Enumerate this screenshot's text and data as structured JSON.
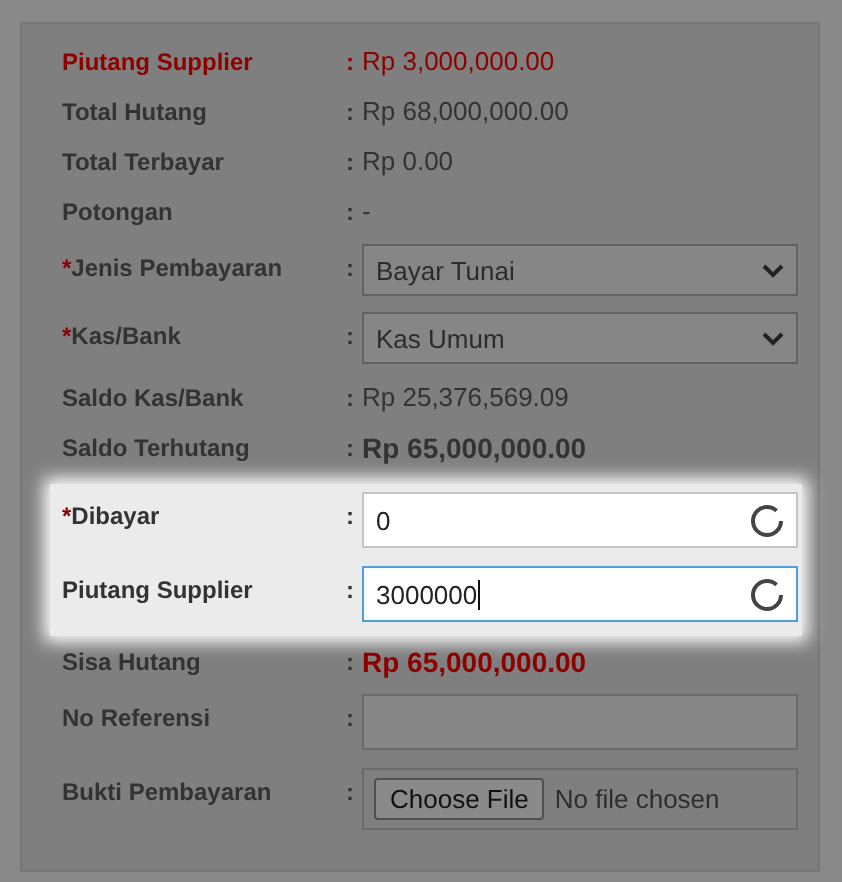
{
  "rows": [
    {
      "kind": "text",
      "label": "Piutang Supplier",
      "colon": ":",
      "value": "Rp 3,000,000.00",
      "alert": true,
      "label_alert": true,
      "bold": false,
      "highlighted": false
    },
    {
      "kind": "text",
      "label": "Total Hutang",
      "colon": ":",
      "value": "Rp 68,000,000.00",
      "alert": false,
      "label_alert": false,
      "bold": false,
      "highlighted": false
    },
    {
      "kind": "text",
      "label": "Total Terbayar",
      "colon": ":",
      "value": "Rp 0.00",
      "alert": false,
      "label_alert": false,
      "bold": false,
      "highlighted": false
    },
    {
      "kind": "text",
      "label": "Potongan",
      "colon": ":",
      "value": "-",
      "alert": false,
      "label_alert": false,
      "bold": false,
      "highlighted": false
    },
    {
      "kind": "select",
      "marker": "*",
      "label": "Jenis Pembayaran",
      "colon": ":",
      "value": "Bayar Tunai",
      "highlighted": false
    },
    {
      "kind": "select",
      "marker": "*",
      "label": "Kas/Bank",
      "colon": ":",
      "value": "Kas Umum",
      "highlighted": false
    },
    {
      "kind": "text",
      "label": "Saldo Kas/Bank",
      "colon": ":",
      "value": "Rp 25,376,569.09",
      "alert": false,
      "label_alert": false,
      "bold": false,
      "highlighted": false
    },
    {
      "kind": "text",
      "label": "Saldo Terhutang",
      "colon": ":",
      "value": "Rp 65,000,000.00",
      "alert": false,
      "label_alert": false,
      "bold": true,
      "highlighted": false
    },
    {
      "kind": "input",
      "marker": "*",
      "label": "Dibayar",
      "colon": ":",
      "value": "0",
      "focused": false,
      "highlighted": true
    },
    {
      "kind": "input",
      "label": "Piutang Supplier",
      "colon": ":",
      "value": "3000000",
      "focused": true,
      "highlighted": true
    },
    {
      "kind": "text",
      "label": "Sisa Hutang",
      "colon": ":",
      "value": "Rp 65,000,000.00",
      "alert": true,
      "label_alert": false,
      "bold": true,
      "highlighted": false
    },
    {
      "kind": "input",
      "label": "No Referensi",
      "colon": ":",
      "focused": false,
      "highlighted": false
    },
    {
      "kind": "file",
      "label": "Bukti Pembayaran",
      "colon": ":",
      "button_label": "Choose File",
      "status": "No file chosen",
      "highlighted": false
    }
  ]
}
